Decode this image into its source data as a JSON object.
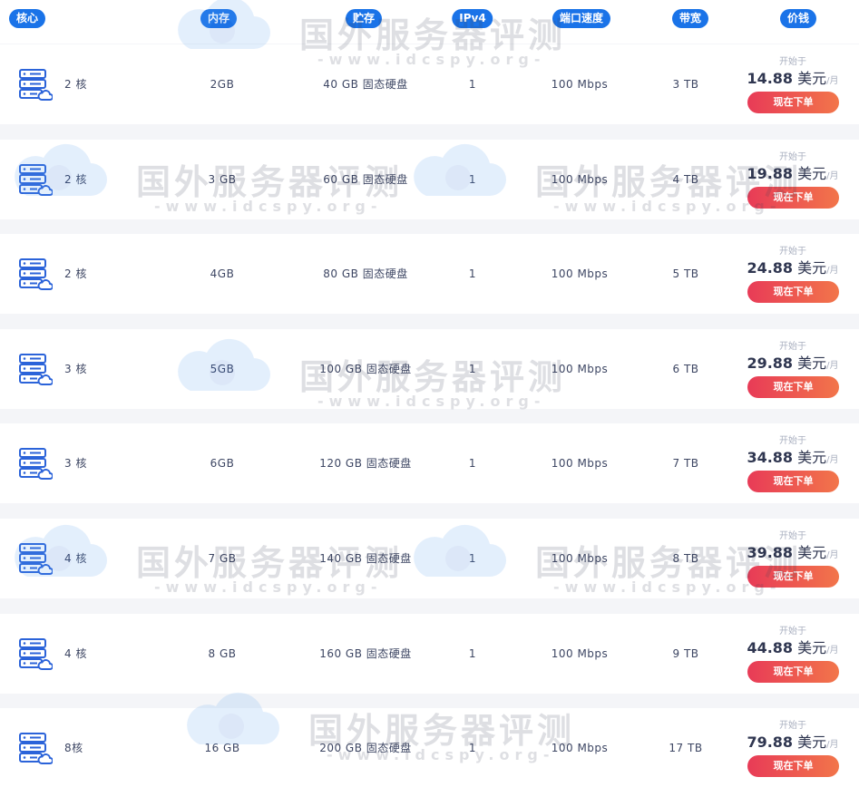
{
  "headers": {
    "cores": "核心",
    "memory": "内存",
    "storage": "贮存",
    "ipv4": "IPv4",
    "port_speed": "端口速度",
    "bandwidth": "带宽",
    "price": "价钱"
  },
  "plans": [
    {
      "cores": "2 核",
      "memory": "2GB",
      "storage": "40 GB 固态硬盘",
      "ipv4": "1",
      "port": "100 Mbps",
      "bandwidth": "3 TB",
      "from": "开始于",
      "price": "14.88",
      "currency": "美元",
      "unit": "/月",
      "button": "现在下单"
    },
    {
      "cores": "2 核",
      "memory": "3 GB",
      "storage": "60 GB 固态硬盘",
      "ipv4": "1",
      "port": "100 Mbps",
      "bandwidth": "4 TB",
      "from": "开始于",
      "price": "19.88",
      "currency": "美元",
      "unit": "/月",
      "button": "现在下单"
    },
    {
      "cores": "2 核",
      "memory": "4GB",
      "storage": "80 GB 固态硬盘",
      "ipv4": "1",
      "port": "100 Mbps",
      "bandwidth": "5 TB",
      "from": "开始于",
      "price": "24.88",
      "currency": "美元",
      "unit": "/月",
      "button": "现在下单"
    },
    {
      "cores": "3 核",
      "memory": "5GB",
      "storage": "100 GB 固态硬盘",
      "ipv4": "1",
      "port": "100 Mbps",
      "bandwidth": "6 TB",
      "from": "开始于",
      "price": "29.88",
      "currency": "美元",
      "unit": "/月",
      "button": "现在下单"
    },
    {
      "cores": "3 核",
      "memory": "6GB",
      "storage": "120 GB 固态硬盘",
      "ipv4": "1",
      "port": "100 Mbps",
      "bandwidth": "7 TB",
      "from": "开始于",
      "price": "34.88",
      "currency": "美元",
      "unit": "/月",
      "button": "现在下单"
    },
    {
      "cores": "4 核",
      "memory": "7 GB",
      "storage": "140 GB 固态硬盘",
      "ipv4": "1",
      "port": "100 Mbps",
      "bandwidth": "8 TB",
      "from": "开始于",
      "price": "39.88",
      "currency": "美元",
      "unit": "/月",
      "button": "现在下单"
    },
    {
      "cores": "4 核",
      "memory": "8 GB",
      "storage": "160 GB 固态硬盘",
      "ipv4": "1",
      "port": "100 Mbps",
      "bandwidth": "9 TB",
      "from": "开始于",
      "price": "44.88",
      "currency": "美元",
      "unit": "/月",
      "button": "现在下单"
    },
    {
      "cores": "8核",
      "memory": "16 GB",
      "storage": "200 GB 固态硬盘",
      "ipv4": "1",
      "port": "100 Mbps",
      "bandwidth": "17 TB",
      "from": "开始于",
      "price": "79.88",
      "currency": "美元",
      "unit": "/月",
      "button": "现在下单"
    }
  ],
  "watermark": {
    "text": "国外服务器评测",
    "sub": "-www.idcspy.org-"
  },
  "colors": {
    "header_pill": "#1a73e8",
    "button_start": "#e83b57",
    "button_end": "#f2754a",
    "icon": "#2b63d9"
  },
  "icons": {
    "plan_icon": "server-cloud-icon"
  }
}
